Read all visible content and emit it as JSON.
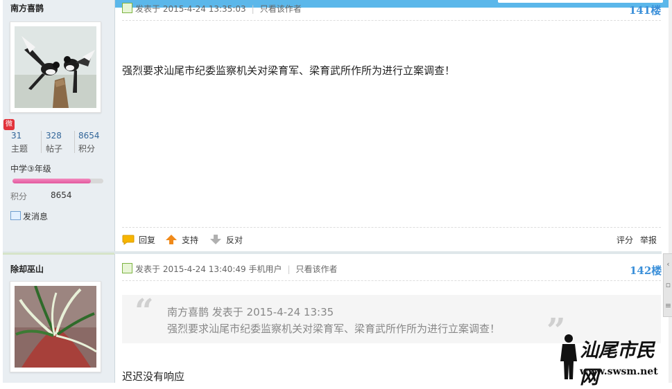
{
  "posts": [
    {
      "author": "南方喜鹊",
      "stats": [
        {
          "num": "31",
          "label": "主题"
        },
        {
          "num": "328",
          "label": "帖子"
        },
        {
          "num": "8654",
          "label": "积分"
        }
      ],
      "grade": "中学③年级",
      "level_progress": 0.86,
      "score_label": "积分",
      "score_value": "8654",
      "send_message": "发消息",
      "posted_at": "发表于 2015-4-24 13:35:03",
      "only_author": "只看该作者",
      "floor": "141楼",
      "content": "强烈要求汕尾市纪委监察机关对梁育军、梁育武所作所为进行立案调查！",
      "actions": {
        "reply": "回复",
        "support": "支持",
        "oppose": "反对",
        "rate": "评分",
        "report": "举报"
      }
    },
    {
      "author": "除却巫山",
      "posted_at": "发表于 2015-4-24 13:40:49",
      "device": "手机用户",
      "only_author": "只看该作者",
      "floor": "142楼",
      "quote_header": "南方喜鹊 发表于 2015-4-24 13:35",
      "quote_body": "强烈要求汕尾市纪委监察机关对梁育军、梁育武所作所为进行立案调查！",
      "content": "迟迟没有响应"
    }
  ],
  "watermark": {
    "cn": "汕尾市民网",
    "url": "www.swsm.net"
  },
  "colors": {
    "accent": "#5bb7ea",
    "floor": "#3a8fd9",
    "progress": "#e3569d"
  }
}
